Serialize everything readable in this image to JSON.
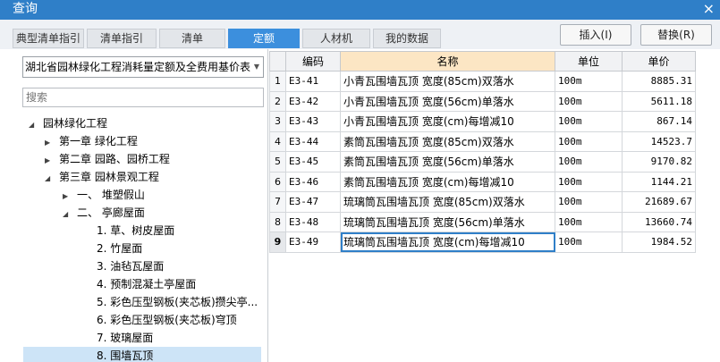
{
  "window": {
    "title": "查询",
    "close_icon": "×"
  },
  "tabs": [
    {
      "label": "典型清单指引",
      "active": false
    },
    {
      "label": "清单指引",
      "active": false
    },
    {
      "label": "清单",
      "active": false
    },
    {
      "label": "定额",
      "active": true
    },
    {
      "label": "人材机",
      "active": false
    },
    {
      "label": "我的数据",
      "active": false
    }
  ],
  "buttons": {
    "insert": "插入(I)",
    "replace": "替换(R)"
  },
  "left": {
    "library": "湖北省园林绿化工程消耗量定额及全费用基价表",
    "search_placeholder": "搜索",
    "tree": [
      {
        "label": "园林绿化工程",
        "expanded": true,
        "selected": false
      },
      {
        "label": "第一章 绿化工程",
        "expanded": false,
        "selected": false
      },
      {
        "label": "第二章 园路、园桥工程",
        "expanded": false,
        "selected": false
      },
      {
        "label": "第三章 园林景观工程",
        "expanded": true,
        "selected": false
      },
      {
        "label": "一、 堆塑假山",
        "expanded": false,
        "selected": false
      },
      {
        "label": "二、 亭廊屋面",
        "expanded": true,
        "selected": false
      },
      {
        "label": "1. 草、树皮屋面",
        "selected": false
      },
      {
        "label": "2. 竹屋面",
        "selected": false
      },
      {
        "label": "3. 油毡瓦屋面",
        "selected": false
      },
      {
        "label": "4. 预制混凝土亭屋面",
        "selected": false
      },
      {
        "label": "5. 彩色压型钢板(夹芯板)攒尖亭...",
        "selected": false
      },
      {
        "label": "6. 彩色压型钢板(夹芯板)穹顶",
        "selected": false
      },
      {
        "label": "7. 玻璃屋面",
        "selected": false
      },
      {
        "label": "8. 围墙瓦顶",
        "selected": true
      }
    ]
  },
  "table": {
    "headers": {
      "code": "编码",
      "name": "名称",
      "unit": "单位",
      "price": "单价"
    },
    "rows": [
      {
        "idx": "1",
        "code": "E3-41",
        "name": "小青瓦围墙瓦顶 宽度(85cm)双落水",
        "unit": "100m",
        "price": "8885.31"
      },
      {
        "idx": "2",
        "code": "E3-42",
        "name": "小青瓦围墙瓦顶 宽度(56cm)单落水",
        "unit": "100m",
        "price": "5611.18"
      },
      {
        "idx": "3",
        "code": "E3-43",
        "name": "小青瓦围墙瓦顶 宽度(cm)每增减10",
        "unit": "100m",
        "price": "867.14"
      },
      {
        "idx": "4",
        "code": "E3-44",
        "name": "素筒瓦围墙瓦顶 宽度(85cm)双落水",
        "unit": "100m",
        "price": "14523.7"
      },
      {
        "idx": "5",
        "code": "E3-45",
        "name": "素筒瓦围墙瓦顶 宽度(56cm)单落水",
        "unit": "100m",
        "price": "9170.82"
      },
      {
        "idx": "6",
        "code": "E3-46",
        "name": "素筒瓦围墙瓦顶 宽度(cm)每增减10",
        "unit": "100m",
        "price": "1144.21"
      },
      {
        "idx": "7",
        "code": "E3-47",
        "name": "琉璃筒瓦围墙瓦顶 宽度(85cm)双落水",
        "unit": "100m",
        "price": "21689.67"
      },
      {
        "idx": "8",
        "code": "E3-48",
        "name": "琉璃筒瓦围墙瓦顶 宽度(56cm)单落水",
        "unit": "100m",
        "price": "13660.74"
      },
      {
        "idx": "9",
        "code": "E3-49",
        "name": "琉璃筒瓦围墙瓦顶 宽度(cm)每增减10",
        "unit": "100m",
        "price": "1984.52"
      }
    ],
    "selected_row": 9
  }
}
